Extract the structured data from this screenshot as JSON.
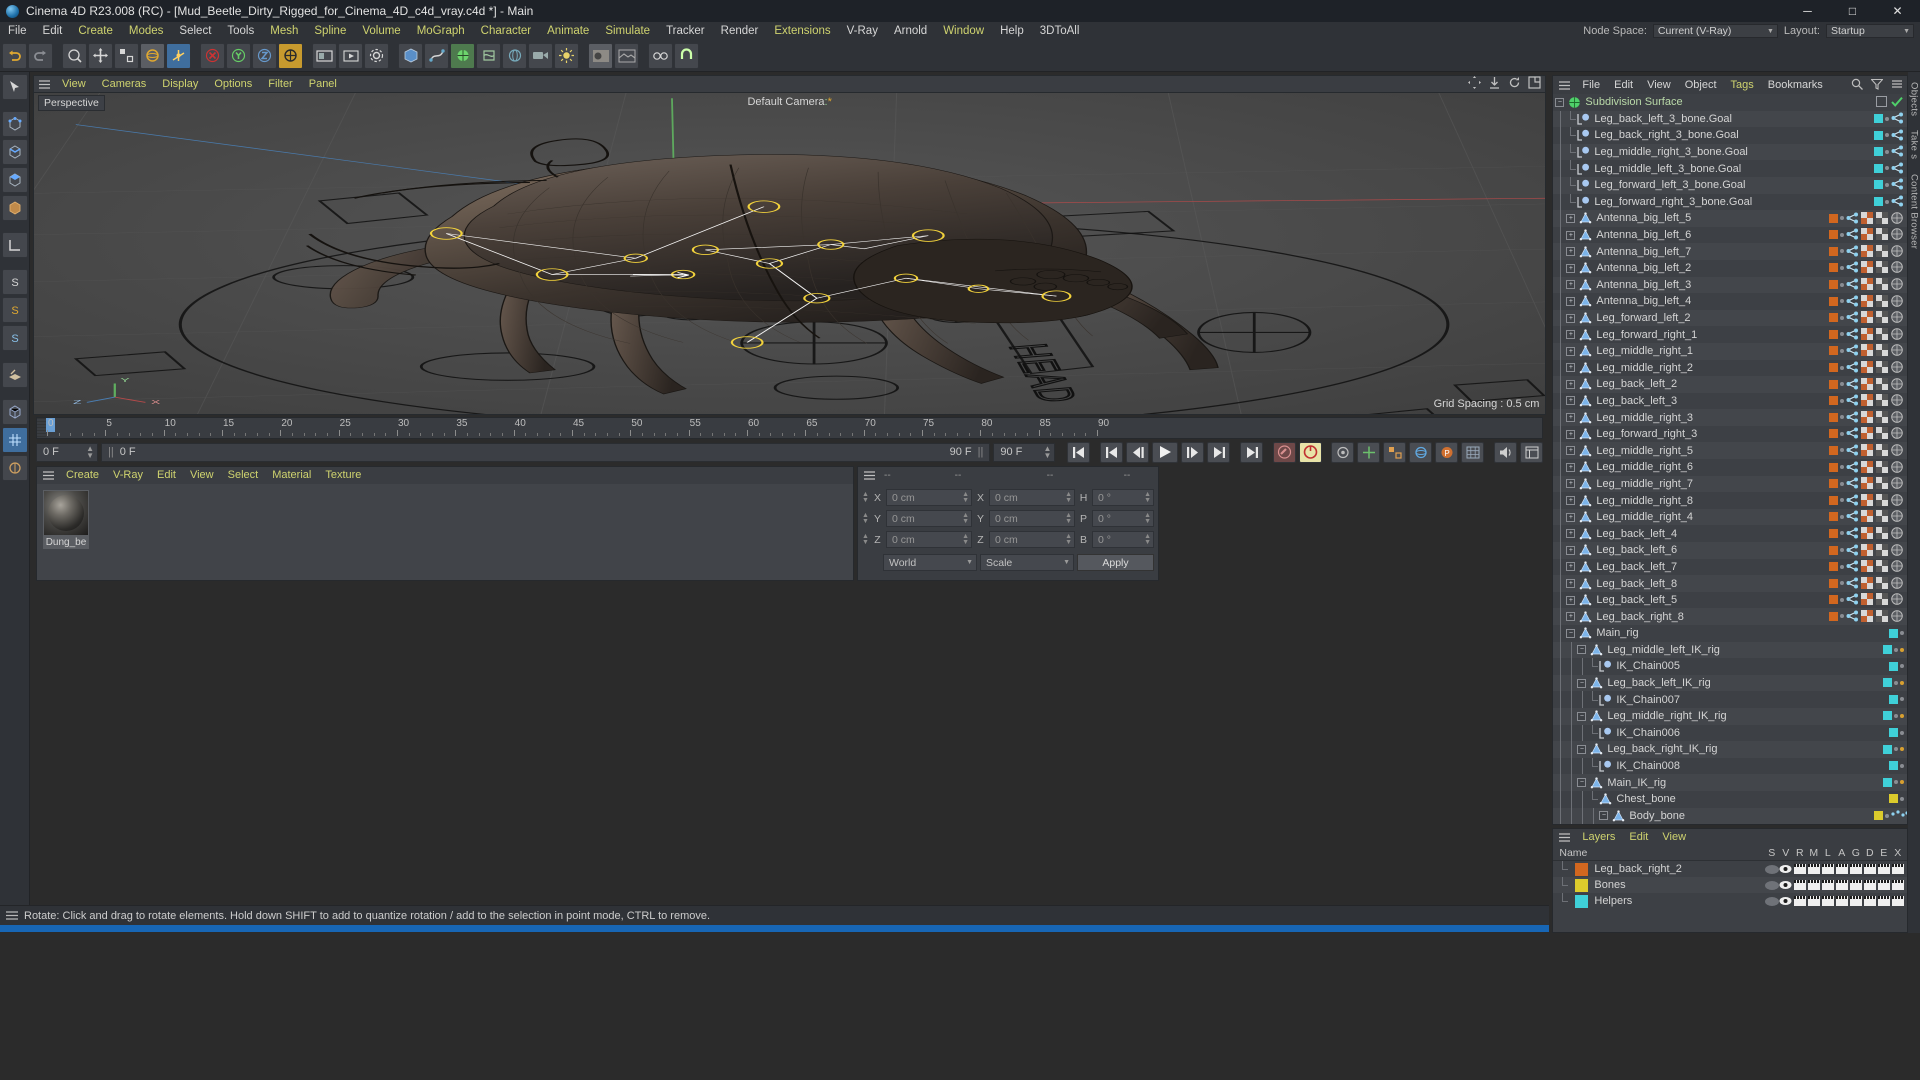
{
  "window": {
    "title": "Cinema 4D R23.008 (RC) - [Mud_Beetle_Dirty_Rigged_for_Cinema_4D_c4d_vray.c4d *] - Main",
    "minimize": "─",
    "maximize": "□",
    "close": "✕"
  },
  "menubar": {
    "items": [
      {
        "label": "File",
        "style": "w"
      },
      {
        "label": "Edit",
        "style": "w"
      },
      {
        "label": "Create",
        "style": "g"
      },
      {
        "label": "Modes",
        "style": "g"
      },
      {
        "label": "Select",
        "style": "w"
      },
      {
        "label": "Tools",
        "style": "w"
      },
      {
        "label": "Mesh",
        "style": "g"
      },
      {
        "label": "Spline",
        "style": "g"
      },
      {
        "label": "Volume",
        "style": "g"
      },
      {
        "label": "MoGraph",
        "style": "g"
      },
      {
        "label": "Character",
        "style": "g"
      },
      {
        "label": "Animate",
        "style": "g"
      },
      {
        "label": "Simulate",
        "style": "g"
      },
      {
        "label": "Tracker",
        "style": "w"
      },
      {
        "label": "Render",
        "style": "w"
      },
      {
        "label": "Extensions",
        "style": "g"
      },
      {
        "label": "V-Ray",
        "style": "w"
      },
      {
        "label": "Arnold",
        "style": "w"
      },
      {
        "label": "Window",
        "style": "g"
      },
      {
        "label": "Help",
        "style": "w"
      },
      {
        "label": "3DToAll",
        "style": "w"
      }
    ],
    "node_space_label": "Node Space:",
    "node_space_value": "Current (V-Ray)",
    "layout_label": "Layout:",
    "layout_value": "Startup"
  },
  "viewport": {
    "menu": [
      "View",
      "Cameras",
      "Display",
      "Options",
      "Filter",
      "Panel"
    ],
    "perspective_label": "Perspective",
    "camera_label": "Default Camera",
    "grid_label": "Grid Spacing : 0.5 cm",
    "head_text": "HEAD"
  },
  "timeline": {
    "ticks": [
      "0",
      "5",
      "10",
      "15",
      "20",
      "25",
      "30",
      "35",
      "40",
      "45",
      "50",
      "55",
      "60",
      "65",
      "70",
      "75",
      "80",
      "85",
      "90"
    ],
    "current_frame": "0 F",
    "current_frame_bar": "0 F",
    "end_frame_left": "90 F",
    "end_frame_right": "90 F",
    "right_frame_field": "0 F"
  },
  "material_manager": {
    "menu": [
      "Create",
      "V-Ray",
      "Edit",
      "View",
      "Select",
      "Material",
      "Texture"
    ],
    "materials": [
      {
        "name": "Dung_be"
      }
    ]
  },
  "coordinates": {
    "title": "--",
    "header_cols": [
      "--",
      "--",
      "--"
    ],
    "rows": [
      {
        "label": "X",
        "value": "0 cm",
        "label2": "X",
        "value2": "0 cm",
        "label3": "H",
        "value3": "0 °"
      },
      {
        "label": "Y",
        "value": "0 cm",
        "label2": "Y",
        "value2": "0 cm",
        "label3": "P",
        "value3": "0 °"
      },
      {
        "label": "Z",
        "value": "0 cm",
        "label2": "Z",
        "value2": "0 cm",
        "label3": "B",
        "value3": "0 °"
      }
    ],
    "system": "World",
    "mode": "Scale",
    "apply": "Apply"
  },
  "status_bar": {
    "text": "Rotate: Click and drag to rotate elements. Hold down SHIFT to add to quantize rotation / add to the selection in point mode, CTRL to remove."
  },
  "object_manager": {
    "menu": [
      {
        "label": "File",
        "style": "w"
      },
      {
        "label": "Edit",
        "style": "w"
      },
      {
        "label": "View",
        "style": "w"
      },
      {
        "label": "Object",
        "style": "w"
      },
      {
        "label": "Tags",
        "style": "g"
      },
      {
        "label": "Bookmarks",
        "style": "w"
      }
    ],
    "objects": [
      {
        "name": "Subdivision Surface",
        "depth": 0,
        "icon": "subdiv",
        "expander": "minus",
        "green": true,
        "tags": "check"
      },
      {
        "name": "Leg_back_left_3_bone.Goal",
        "depth": 1,
        "icon": "null",
        "expander": "none",
        "dot": "cy",
        "tags": "anim"
      },
      {
        "name": "Leg_back_right_3_bone.Goal",
        "depth": 1,
        "icon": "null",
        "expander": "none",
        "dot": "cy",
        "tags": "anim"
      },
      {
        "name": "Leg_middle_right_3_bone.Goal",
        "depth": 1,
        "icon": "null",
        "expander": "none",
        "dot": "cy",
        "tags": "anim"
      },
      {
        "name": "Leg_middle_left_3_bone.Goal",
        "depth": 1,
        "icon": "null",
        "expander": "none",
        "dot": "cy",
        "tags": "anim"
      },
      {
        "name": "Leg_forward_left_3_bone.Goal",
        "depth": 1,
        "icon": "null",
        "expander": "none",
        "dot": "cy",
        "tags": "anim"
      },
      {
        "name": "Leg_forward_right_3_bone.Goal",
        "depth": 1,
        "icon": "null",
        "expander": "none",
        "dot": "cy",
        "tags": "anim"
      },
      {
        "name": "Antenna_big_left_5",
        "depth": 1,
        "icon": "joint",
        "expander": "plus",
        "dot": "or",
        "tags": "full"
      },
      {
        "name": "Antenna_big_left_6",
        "depth": 1,
        "icon": "joint",
        "expander": "plus",
        "dot": "or",
        "tags": "full"
      },
      {
        "name": "Antenna_big_left_7",
        "depth": 1,
        "icon": "joint",
        "expander": "plus",
        "dot": "or",
        "tags": "full"
      },
      {
        "name": "Antenna_big_left_2",
        "depth": 1,
        "icon": "joint",
        "expander": "plus",
        "dot": "or",
        "tags": "full"
      },
      {
        "name": "Antenna_big_left_3",
        "depth": 1,
        "icon": "joint",
        "expander": "plus",
        "dot": "or",
        "tags": "full"
      },
      {
        "name": "Antenna_big_left_4",
        "depth": 1,
        "icon": "joint",
        "expander": "plus",
        "dot": "or",
        "tags": "full"
      },
      {
        "name": "Leg_forward_left_2",
        "depth": 1,
        "icon": "joint",
        "expander": "plus",
        "dot": "or",
        "tags": "full"
      },
      {
        "name": "Leg_forward_right_1",
        "depth": 1,
        "icon": "joint",
        "expander": "plus",
        "dot": "or",
        "tags": "full"
      },
      {
        "name": "Leg_middle_right_1",
        "depth": 1,
        "icon": "joint",
        "expander": "plus",
        "dot": "or",
        "tags": "full"
      },
      {
        "name": "Leg_middle_right_2",
        "depth": 1,
        "icon": "joint",
        "expander": "plus",
        "dot": "or",
        "tags": "full"
      },
      {
        "name": "Leg_back_left_2",
        "depth": 1,
        "icon": "joint",
        "expander": "plus",
        "dot": "or",
        "tags": "full"
      },
      {
        "name": "Leg_back_left_3",
        "depth": 1,
        "icon": "joint",
        "expander": "plus",
        "dot": "or",
        "tags": "full"
      },
      {
        "name": "Leg_middle_right_3",
        "depth": 1,
        "icon": "joint",
        "expander": "plus",
        "dot": "or",
        "tags": "full"
      },
      {
        "name": "Leg_forward_right_3",
        "depth": 1,
        "icon": "joint",
        "expander": "plus",
        "dot": "or",
        "tags": "full"
      },
      {
        "name": "Leg_middle_right_5",
        "depth": 1,
        "icon": "joint",
        "expander": "plus",
        "dot": "or",
        "tags": "full"
      },
      {
        "name": "Leg_middle_right_6",
        "depth": 1,
        "icon": "joint",
        "expander": "plus",
        "dot": "or",
        "tags": "full"
      },
      {
        "name": "Leg_middle_right_7",
        "depth": 1,
        "icon": "joint",
        "expander": "plus",
        "dot": "or",
        "tags": "full"
      },
      {
        "name": "Leg_middle_right_8",
        "depth": 1,
        "icon": "joint",
        "expander": "plus",
        "dot": "or",
        "tags": "full"
      },
      {
        "name": "Leg_middle_right_4",
        "depth": 1,
        "icon": "joint",
        "expander": "plus",
        "dot": "or",
        "tags": "full"
      },
      {
        "name": "Leg_back_left_4",
        "depth": 1,
        "icon": "joint",
        "expander": "plus",
        "dot": "or",
        "tags": "full"
      },
      {
        "name": "Leg_back_left_6",
        "depth": 1,
        "icon": "joint",
        "expander": "plus",
        "dot": "or",
        "tags": "full"
      },
      {
        "name": "Leg_back_left_7",
        "depth": 1,
        "icon": "joint",
        "expander": "plus",
        "dot": "or",
        "tags": "full"
      },
      {
        "name": "Leg_back_left_8",
        "depth": 1,
        "icon": "joint",
        "expander": "plus",
        "dot": "or",
        "tags": "full"
      },
      {
        "name": "Leg_back_left_5",
        "depth": 1,
        "icon": "joint",
        "expander": "plus",
        "dot": "or",
        "tags": "full"
      },
      {
        "name": "Leg_back_right_8",
        "depth": 1,
        "icon": "joint",
        "expander": "plus",
        "dot": "or",
        "tags": "full"
      },
      {
        "name": "Main_rig",
        "depth": 1,
        "icon": "joint",
        "expander": "minus",
        "dot": "cy",
        "tags": "none"
      },
      {
        "name": "Leg_middle_left_IK_rig",
        "depth": 2,
        "icon": "joint",
        "expander": "minus",
        "dot": "cy",
        "tags": "dot"
      },
      {
        "name": "IK_Chain005",
        "depth": 3,
        "icon": "null",
        "expander": "none",
        "dot": "cy",
        "tags": "none"
      },
      {
        "name": "Leg_back_left_IK_rig",
        "depth": 2,
        "icon": "joint",
        "expander": "minus",
        "dot": "cy",
        "tags": "dot"
      },
      {
        "name": "IK_Chain007",
        "depth": 3,
        "icon": "null",
        "expander": "none",
        "dot": "cy",
        "tags": "none"
      },
      {
        "name": "Leg_middle_right_IK_rig",
        "depth": 2,
        "icon": "joint",
        "expander": "minus",
        "dot": "cy",
        "tags": "dot"
      },
      {
        "name": "IK_Chain006",
        "depth": 3,
        "icon": "null",
        "expander": "none",
        "dot": "cy",
        "tags": "none"
      },
      {
        "name": "Leg_back_right_IK_rig",
        "depth": 2,
        "icon": "joint",
        "expander": "minus",
        "dot": "cy",
        "tags": "dot"
      },
      {
        "name": "IK_Chain008",
        "depth": 3,
        "icon": "null",
        "expander": "none",
        "dot": "cy",
        "tags": "none"
      },
      {
        "name": "Main_IK_rig",
        "depth": 2,
        "icon": "joint",
        "expander": "minus",
        "dot": "cy",
        "tags": "dot"
      },
      {
        "name": "Chest_bone",
        "depth": 3,
        "icon": "joint",
        "expander": "none",
        "dot": "ye",
        "tags": "none"
      },
      {
        "name": "Body_bone",
        "depth": 4,
        "icon": "joint",
        "expander": "minus",
        "dot": "ye",
        "tags": "dots"
      }
    ]
  },
  "layers_panel": {
    "menu": [
      "Layers",
      "Edit",
      "View"
    ],
    "columns": [
      "Name",
      "S",
      "V",
      "R",
      "M",
      "L",
      "A",
      "G",
      "D",
      "E",
      "X"
    ],
    "rows": [
      {
        "name": "Leg_back_right_2",
        "color": "#d2671f"
      },
      {
        "name": "Bones",
        "color": "#dccb2c"
      },
      {
        "name": "Helpers",
        "color": "#3fd0d8"
      }
    ]
  },
  "right_tabs": [
    "Objects",
    "Take s",
    "Content Browser"
  ]
}
